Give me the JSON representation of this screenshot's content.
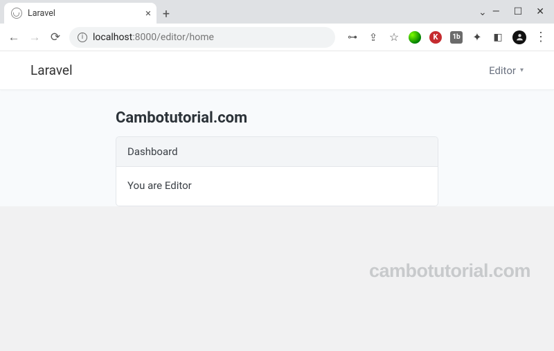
{
  "browser": {
    "tab_title": "Laravel",
    "url_host": "localhost",
    "url_port_path": ":8000/editor/home"
  },
  "icons": {
    "close": "×",
    "newtab": "+",
    "minimize": "—",
    "maximize": "☐",
    "win_close": "✕",
    "chev": "⌄",
    "back": "←",
    "forward": "→",
    "reload": "⟳",
    "info": "i",
    "key": "⊶",
    "share": "⇪",
    "star": "☆",
    "puzzle": "✦",
    "panels": "◧",
    "kebab": "⋮"
  },
  "ext": {
    "k_label": "K",
    "ib_label": "1b"
  },
  "app": {
    "brand": "Laravel",
    "user_menu_label": "Editor",
    "caret": "▾",
    "page_heading": "Cambotutorial.com",
    "card_header": "Dashboard",
    "card_body": "You are Editor"
  },
  "watermark": "cambotutorial.com"
}
